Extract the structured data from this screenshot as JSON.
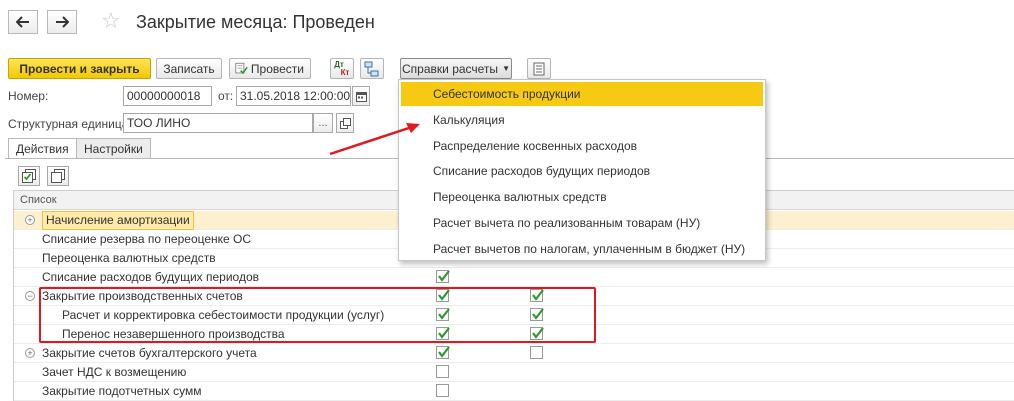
{
  "header": {
    "title": "Закрытие месяца: Проведен",
    "back_icon": "arrow-left-icon",
    "forward_icon": "arrow-right-icon",
    "favorite_icon": "star-icon"
  },
  "toolbar": {
    "post_and_close": "Провести и закрыть",
    "save": "Записать",
    "post": "Провести",
    "dt_kt_top": "Дт",
    "dt_kt_bottom": "Кт",
    "reports_menu": "Справки расчеты",
    "accent": "#f3c800"
  },
  "form": {
    "number_label": "Номер:",
    "number_value": "00000000018",
    "from_label": "от:",
    "date_value": "31.05.2018 12:00:00",
    "unit_label": "Структурная единица:",
    "unit_value": "ТОО ЛИНО",
    "unit_select_btn": "..."
  },
  "tabs": [
    "Действия",
    "Настройки"
  ],
  "list": {
    "header": "Список",
    "rows": [
      {
        "label": "Начисление амортизации",
        "expand": "+",
        "indent": 0,
        "c1": null,
        "c2": null
      },
      {
        "label": "Списание резерва по переоценке ОС",
        "expand": "",
        "indent": 0,
        "c1": null,
        "c2": null
      },
      {
        "label": "Переоценка валютных средств",
        "expand": "",
        "indent": 0,
        "c1": null,
        "c2": null
      },
      {
        "label": "Списание расходов будущих периодов",
        "expand": "",
        "indent": 0,
        "c1": true,
        "c2": null
      },
      {
        "label": "Закрытие производственных счетов",
        "expand": "−",
        "indent": 0,
        "c1": true,
        "c2": true
      },
      {
        "label": "Расчет и корректировка себестоимости продукции (услуг)",
        "expand": "",
        "indent": 1,
        "c1": true,
        "c2": true
      },
      {
        "label": "Перенос незавершенного производства",
        "expand": "",
        "indent": 1,
        "c1": true,
        "c2": true
      },
      {
        "label": "Закрытие счетов бухгалтерского учета",
        "expand": "+",
        "indent": 0,
        "c1": true,
        "c2": false
      },
      {
        "label": "Зачет НДС к возмещению",
        "expand": "",
        "indent": 0,
        "c1": false,
        "c2": null
      },
      {
        "label": "Закрытие подотчетных сумм",
        "expand": "",
        "indent": 0,
        "c1": false,
        "c2": null
      }
    ],
    "check_color": "#2d9a2d"
  },
  "dropdown": {
    "items": [
      "Себестоимость продукции",
      "Калькуляция",
      "Распределение косвенных расходов",
      "Списание расходов будущих периодов",
      "Переоценка валютных средств",
      "Расчет вычета по реализованным товарам (НУ)",
      "Расчет вычетов по налогам, уплаченным в бюджет (НУ)"
    ],
    "highlighted_index": 0,
    "highlight_color": "#f6c912"
  },
  "annotation": {
    "box_color": "#e0191d",
    "arrow_color": "#e0191d"
  }
}
